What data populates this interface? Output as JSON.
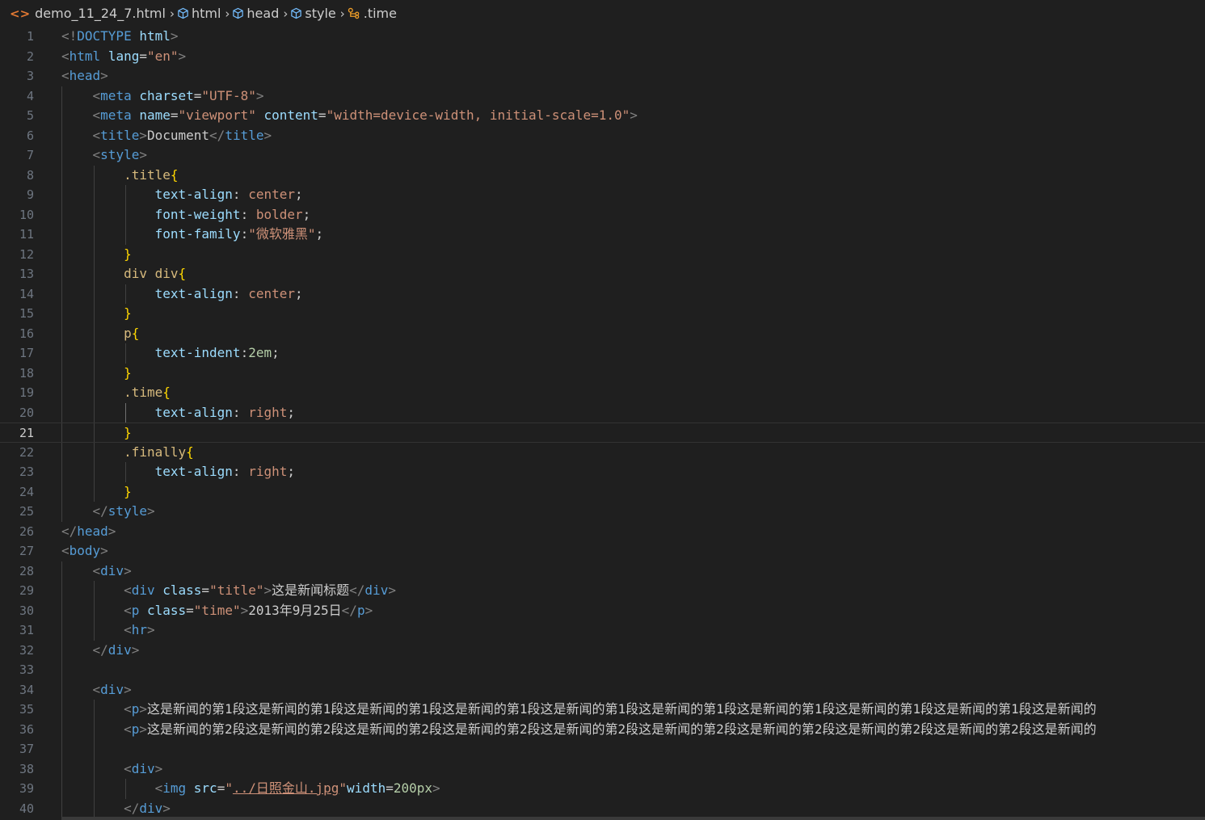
{
  "breadcrumb": {
    "file": "demo_11_24_7.html",
    "items": [
      "html",
      "head",
      "style",
      ".time"
    ]
  },
  "editor": {
    "current_line": 21,
    "lines": [
      {
        "n": "1",
        "tokens": [
          [
            "t-br",
            "<!"
          ],
          [
            "t-tag",
            "DOCTYPE"
          ],
          [
            "t-text",
            " "
          ],
          [
            "t-attr",
            "html"
          ],
          [
            "t-br",
            ">"
          ]
        ]
      },
      {
        "n": "2",
        "tokens": [
          [
            "t-br",
            "<"
          ],
          [
            "t-tag",
            "html"
          ],
          [
            "t-text",
            " "
          ],
          [
            "t-attr",
            "lang"
          ],
          [
            "t-text",
            "="
          ],
          [
            "t-str",
            "\"en\""
          ],
          [
            "t-br",
            ">"
          ]
        ]
      },
      {
        "n": "3",
        "tokens": [
          [
            "t-br",
            "<"
          ],
          [
            "t-tag",
            "head"
          ],
          [
            "t-br",
            ">"
          ]
        ]
      },
      {
        "n": "4",
        "tokens": [
          [
            "t-text",
            "    "
          ],
          [
            "t-br",
            "<"
          ],
          [
            "t-tag",
            "meta"
          ],
          [
            "t-text",
            " "
          ],
          [
            "t-attr",
            "charset"
          ],
          [
            "t-text",
            "="
          ],
          [
            "t-str",
            "\"UTF-8\""
          ],
          [
            "t-br",
            ">"
          ]
        ]
      },
      {
        "n": "5",
        "tokens": [
          [
            "t-text",
            "    "
          ],
          [
            "t-br",
            "<"
          ],
          [
            "t-tag",
            "meta"
          ],
          [
            "t-text",
            " "
          ],
          [
            "t-attr",
            "name"
          ],
          [
            "t-text",
            "="
          ],
          [
            "t-str",
            "\"viewport\""
          ],
          [
            "t-text",
            " "
          ],
          [
            "t-attr",
            "content"
          ],
          [
            "t-text",
            "="
          ],
          [
            "t-str",
            "\"width=device-width, initial-scale=1.0\""
          ],
          [
            "t-br",
            ">"
          ]
        ]
      },
      {
        "n": "6",
        "tokens": [
          [
            "t-text",
            "    "
          ],
          [
            "t-br",
            "<"
          ],
          [
            "t-tag",
            "title"
          ],
          [
            "t-br",
            ">"
          ],
          [
            "t-text",
            "Document"
          ],
          [
            "t-br",
            "</"
          ],
          [
            "t-tag",
            "title"
          ],
          [
            "t-br",
            ">"
          ]
        ]
      },
      {
        "n": "7",
        "tokens": [
          [
            "t-text",
            "    "
          ],
          [
            "t-br",
            "<"
          ],
          [
            "t-tag",
            "style"
          ],
          [
            "t-br",
            ">"
          ]
        ]
      },
      {
        "n": "8",
        "tokens": [
          [
            "t-text",
            "        "
          ],
          [
            "t-sel",
            ".title"
          ],
          [
            "t-brace",
            "{"
          ]
        ]
      },
      {
        "n": "9",
        "tokens": [
          [
            "t-text",
            "            "
          ],
          [
            "t-prop",
            "text-align"
          ],
          [
            "t-text",
            ": "
          ],
          [
            "t-val",
            "center"
          ],
          [
            "t-text",
            ";"
          ]
        ]
      },
      {
        "n": "10",
        "tokens": [
          [
            "t-text",
            "            "
          ],
          [
            "t-prop",
            "font-weight"
          ],
          [
            "t-text",
            ": "
          ],
          [
            "t-val",
            "bolder"
          ],
          [
            "t-text",
            ";"
          ]
        ]
      },
      {
        "n": "11",
        "tokens": [
          [
            "t-text",
            "            "
          ],
          [
            "t-prop",
            "font-family"
          ],
          [
            "t-text",
            ":"
          ],
          [
            "t-str",
            "\"微软雅黑\""
          ],
          [
            "t-text",
            ";"
          ]
        ]
      },
      {
        "n": "12",
        "tokens": [
          [
            "t-text",
            "        "
          ],
          [
            "t-brace",
            "}"
          ]
        ]
      },
      {
        "n": "13",
        "tokens": [
          [
            "t-text",
            "        "
          ],
          [
            "t-sel",
            "div div"
          ],
          [
            "t-brace",
            "{"
          ]
        ]
      },
      {
        "n": "14",
        "tokens": [
          [
            "t-text",
            "            "
          ],
          [
            "t-prop",
            "text-align"
          ],
          [
            "t-text",
            ": "
          ],
          [
            "t-val",
            "center"
          ],
          [
            "t-text",
            ";"
          ]
        ]
      },
      {
        "n": "15",
        "tokens": [
          [
            "t-text",
            "        "
          ],
          [
            "t-brace",
            "}"
          ]
        ]
      },
      {
        "n": "16",
        "tokens": [
          [
            "t-text",
            "        "
          ],
          [
            "t-sel",
            "p"
          ],
          [
            "t-brace",
            "{"
          ]
        ]
      },
      {
        "n": "17",
        "tokens": [
          [
            "t-text",
            "            "
          ],
          [
            "t-prop",
            "text-indent"
          ],
          [
            "t-text",
            ":"
          ],
          [
            "t-num",
            "2em"
          ],
          [
            "t-text",
            ";"
          ]
        ]
      },
      {
        "n": "18",
        "tokens": [
          [
            "t-text",
            "        "
          ],
          [
            "t-brace",
            "}"
          ]
        ]
      },
      {
        "n": "19",
        "tokens": [
          [
            "t-text",
            "        "
          ],
          [
            "t-sel",
            ".time"
          ],
          [
            "t-brace",
            "{"
          ]
        ]
      },
      {
        "n": "20",
        "tokens": [
          [
            "t-text",
            "            "
          ],
          [
            "t-prop",
            "text-align"
          ],
          [
            "t-text",
            ": "
          ],
          [
            "t-val",
            "right"
          ],
          [
            "t-text",
            ";"
          ]
        ]
      },
      {
        "n": "21",
        "tokens": [
          [
            "t-text",
            "        "
          ],
          [
            "t-brace",
            "}"
          ]
        ]
      },
      {
        "n": "22",
        "tokens": [
          [
            "t-text",
            "        "
          ],
          [
            "t-sel",
            ".finally"
          ],
          [
            "t-brace",
            "{"
          ]
        ]
      },
      {
        "n": "23",
        "tokens": [
          [
            "t-text",
            "            "
          ],
          [
            "t-prop",
            "text-align"
          ],
          [
            "t-text",
            ": "
          ],
          [
            "t-val",
            "right"
          ],
          [
            "t-text",
            ";"
          ]
        ]
      },
      {
        "n": "24",
        "tokens": [
          [
            "t-text",
            "        "
          ],
          [
            "t-brace",
            "}"
          ]
        ]
      },
      {
        "n": "25",
        "tokens": [
          [
            "t-text",
            "    "
          ],
          [
            "t-br",
            "</"
          ],
          [
            "t-tag",
            "style"
          ],
          [
            "t-br",
            ">"
          ]
        ]
      },
      {
        "n": "26",
        "tokens": [
          [
            "t-br",
            "</"
          ],
          [
            "t-tag",
            "head"
          ],
          [
            "t-br",
            ">"
          ]
        ]
      },
      {
        "n": "27",
        "tokens": [
          [
            "t-br",
            "<"
          ],
          [
            "t-tag",
            "body"
          ],
          [
            "t-br",
            ">"
          ]
        ]
      },
      {
        "n": "28",
        "tokens": [
          [
            "t-text",
            "    "
          ],
          [
            "t-br",
            "<"
          ],
          [
            "t-tag",
            "div"
          ],
          [
            "t-br",
            ">"
          ]
        ]
      },
      {
        "n": "29",
        "tokens": [
          [
            "t-text",
            "        "
          ],
          [
            "t-br",
            "<"
          ],
          [
            "t-tag",
            "div"
          ],
          [
            "t-text",
            " "
          ],
          [
            "t-attr",
            "class"
          ],
          [
            "t-text",
            "="
          ],
          [
            "t-str",
            "\"title\""
          ],
          [
            "t-br",
            ">"
          ],
          [
            "t-text",
            "这是新闻标题"
          ],
          [
            "t-br",
            "</"
          ],
          [
            "t-tag",
            "div"
          ],
          [
            "t-br",
            ">"
          ]
        ]
      },
      {
        "n": "30",
        "tokens": [
          [
            "t-text",
            "        "
          ],
          [
            "t-br",
            "<"
          ],
          [
            "t-tag",
            "p"
          ],
          [
            "t-text",
            " "
          ],
          [
            "t-attr",
            "class"
          ],
          [
            "t-text",
            "="
          ],
          [
            "t-str",
            "\"time\""
          ],
          [
            "t-br",
            ">"
          ],
          [
            "t-text",
            "2013年9月25日"
          ],
          [
            "t-br",
            "</"
          ],
          [
            "t-tag",
            "p"
          ],
          [
            "t-br",
            ">"
          ]
        ]
      },
      {
        "n": "31",
        "tokens": [
          [
            "t-text",
            "        "
          ],
          [
            "t-br",
            "<"
          ],
          [
            "t-tag",
            "hr"
          ],
          [
            "t-br",
            ">"
          ]
        ]
      },
      {
        "n": "32",
        "tokens": [
          [
            "t-text",
            "    "
          ],
          [
            "t-br",
            "</"
          ],
          [
            "t-tag",
            "div"
          ],
          [
            "t-br",
            ">"
          ]
        ]
      },
      {
        "n": "33",
        "tokens": []
      },
      {
        "n": "34",
        "tokens": [
          [
            "t-text",
            "    "
          ],
          [
            "t-br",
            "<"
          ],
          [
            "t-tag",
            "div"
          ],
          [
            "t-br",
            ">"
          ]
        ]
      },
      {
        "n": "35",
        "tokens": [
          [
            "t-text",
            "        "
          ],
          [
            "t-br",
            "<"
          ],
          [
            "t-tag",
            "p"
          ],
          [
            "t-br",
            ">"
          ],
          [
            "t-text",
            "这是新闻的第1段这是新闻的第1段这是新闻的第1段这是新闻的第1段这是新闻的第1段这是新闻的第1段这是新闻的第1段这是新闻的第1段这是新闻的第1段这是新闻的"
          ]
        ]
      },
      {
        "n": "36",
        "tokens": [
          [
            "t-text",
            "        "
          ],
          [
            "t-br",
            "<"
          ],
          [
            "t-tag",
            "p"
          ],
          [
            "t-br",
            ">"
          ],
          [
            "t-text",
            "这是新闻的第2段这是新闻的第2段这是新闻的第2段这是新闻的第2段这是新闻的第2段这是新闻的第2段这是新闻的第2段这是新闻的第2段这是新闻的第2段这是新闻的"
          ]
        ]
      },
      {
        "n": "37",
        "tokens": []
      },
      {
        "n": "38",
        "tokens": [
          [
            "t-text",
            "        "
          ],
          [
            "t-br",
            "<"
          ],
          [
            "t-tag",
            "div"
          ],
          [
            "t-br",
            ">"
          ]
        ]
      },
      {
        "n": "39",
        "tokens": [
          [
            "t-text",
            "            "
          ],
          [
            "t-br",
            "<"
          ],
          [
            "t-tag",
            "img"
          ],
          [
            "t-text",
            " "
          ],
          [
            "t-attr",
            "src"
          ],
          [
            "t-text",
            "="
          ],
          [
            "t-str",
            "\""
          ],
          [
            "t-link",
            "../日照金山.jpg"
          ],
          [
            "t-str",
            "\""
          ],
          [
            "t-attr",
            "width"
          ],
          [
            "t-text",
            "="
          ],
          [
            "t-num",
            "200px"
          ],
          [
            "t-br",
            ">"
          ]
        ]
      },
      {
        "n": "40",
        "tokens": [
          [
            "t-text",
            "        "
          ],
          [
            "t-br",
            "</"
          ],
          [
            "t-tag",
            "div"
          ],
          [
            "t-br",
            ">"
          ]
        ]
      }
    ]
  }
}
